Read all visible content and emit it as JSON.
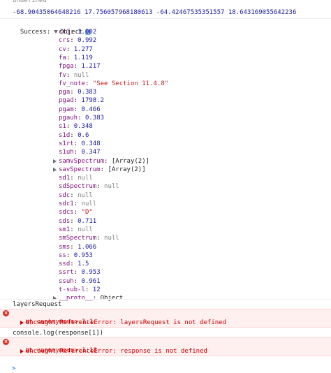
{
  "console": {
    "first_line": "undefined",
    "coords_line": "-68.90435064648216 17.756057968180613 -64.42467535351557 18.643169055642236",
    "success_label": "Success:",
    "object_label": "Object",
    "info_icon": "i",
    "properties": [
      {
        "key": "cr1",
        "value": "1.002",
        "type": "num"
      },
      {
        "key": "crs",
        "value": "0.992",
        "type": "num"
      },
      {
        "key": "cv",
        "value": "1.277",
        "type": "num"
      },
      {
        "key": "fa",
        "value": "1.119",
        "type": "num"
      },
      {
        "key": "fpga",
        "value": "1.217",
        "type": "num"
      },
      {
        "key": "fv",
        "value": "null",
        "type": "null"
      },
      {
        "key": "fv_note",
        "value": "\"See Section 11.4.8\"",
        "type": "str"
      },
      {
        "key": "pga",
        "value": "0.383",
        "type": "num"
      },
      {
        "key": "pgad",
        "value": "1798.2",
        "type": "num"
      },
      {
        "key": "pgam",
        "value": "0.466",
        "type": "num"
      },
      {
        "key": "pgauh",
        "value": "0.383",
        "type": "num"
      },
      {
        "key": "s1",
        "value": "0.348",
        "type": "num"
      },
      {
        "key": "s1d",
        "value": "0.6",
        "type": "num"
      },
      {
        "key": "s1rt",
        "value": "0.348",
        "type": "num"
      },
      {
        "key": "s1uh",
        "value": "0.347",
        "type": "num"
      },
      {
        "key": "samvSpectrum",
        "value": "[Array(2)]",
        "type": "arr"
      },
      {
        "key": "savSpectrum",
        "value": "[Array(2)]",
        "type": "arr"
      },
      {
        "key": "sd1",
        "value": "null",
        "type": "null"
      },
      {
        "key": "sdSpectrum",
        "value": "null",
        "type": "null"
      },
      {
        "key": "sdc",
        "value": "null",
        "type": "null"
      },
      {
        "key": "sdc1",
        "value": "null",
        "type": "null"
      },
      {
        "key": "sdcs",
        "value": "\"D\"",
        "type": "str"
      },
      {
        "key": "sds",
        "value": "0.711",
        "type": "num"
      },
      {
        "key": "sm1",
        "value": "null",
        "type": "null"
      },
      {
        "key": "smSpectrum",
        "value": "null",
        "type": "null"
      },
      {
        "key": "sms",
        "value": "1.066",
        "type": "num"
      },
      {
        "key": "ss",
        "value": "0.953",
        "type": "num"
      },
      {
        "key": "ssd",
        "value": "1.5",
        "type": "num"
      },
      {
        "key": "ssrt",
        "value": "0.953",
        "type": "num"
      },
      {
        "key": "ssuh",
        "value": "0.961",
        "type": "num"
      },
      {
        "key": "t-sub-l",
        "value": "12",
        "type": "num"
      },
      {
        "key": "__proto__",
        "value": "Object",
        "type": "arr"
      }
    ],
    "cmd1": "layersRequest",
    "err1_line1": "Uncaught ReferenceError: layersRequest is not defined",
    "err1_line2": "at <anonymous>:1:1",
    "cmd2": "console.log(response[1])",
    "err2_line1": "Uncaught ReferenceError: response is not defined",
    "err2_line2": "at <anonymous>:1:13",
    "prompt_symbol": ">",
    "error_icon": "×"
  }
}
